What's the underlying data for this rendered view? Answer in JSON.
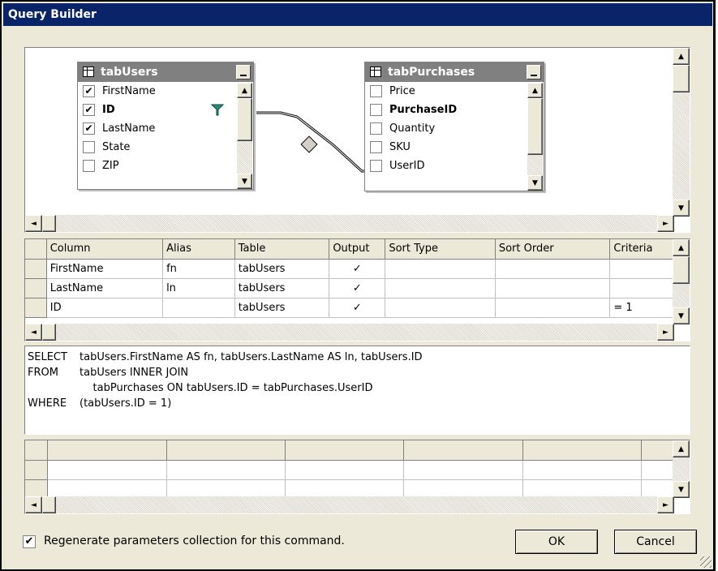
{
  "window": {
    "title": "Query Builder"
  },
  "diagram": {
    "tables": [
      {
        "name": "tabUsers",
        "columns": [
          {
            "name": "FirstName",
            "checked": true,
            "bold": false
          },
          {
            "name": "ID",
            "checked": true,
            "bold": true,
            "filter": true
          },
          {
            "name": "LastName",
            "checked": true,
            "bold": false
          },
          {
            "name": "State",
            "checked": false,
            "bold": false
          },
          {
            "name": "ZIP",
            "checked": false,
            "bold": false
          }
        ]
      },
      {
        "name": "tabPurchases",
        "columns": [
          {
            "name": "Price",
            "checked": false,
            "bold": false
          },
          {
            "name": "PurchaseID",
            "checked": false,
            "bold": true
          },
          {
            "name": "Quantity",
            "checked": false,
            "bold": false
          },
          {
            "name": "SKU",
            "checked": false,
            "bold": false
          },
          {
            "name": "UserID",
            "checked": false,
            "bold": false
          }
        ]
      }
    ]
  },
  "grid": {
    "headers": [
      "Column",
      "Alias",
      "Table",
      "Output",
      "Sort Type",
      "Sort Order",
      "Criteria"
    ],
    "rows": [
      [
        "FirstName",
        "fn",
        "tabUsers",
        "✓",
        "",
        "",
        ""
      ],
      [
        "LastName",
        "ln",
        "tabUsers",
        "✓",
        "",
        "",
        ""
      ],
      [
        "ID",
        "",
        "tabUsers",
        "✓",
        "",
        "",
        "= 1"
      ]
    ]
  },
  "sql": {
    "lines": [
      {
        "keyword": "SELECT",
        "text": "tabUsers.FirstName AS fn, tabUsers.LastName AS ln, tabUsers.ID"
      },
      {
        "keyword": "FROM",
        "text": "tabUsers INNER JOIN"
      },
      {
        "keyword": "",
        "text": "    tabPurchases ON tabUsers.ID = tabPurchases.UserID"
      },
      {
        "keyword": "WHERE",
        "text": "(tabUsers.ID = 1)"
      }
    ]
  },
  "options": {
    "regenerate_label": "Regenerate parameters collection for this command.",
    "regenerate_checked": true
  },
  "buttons": {
    "ok": "OK",
    "cancel": "Cancel"
  }
}
